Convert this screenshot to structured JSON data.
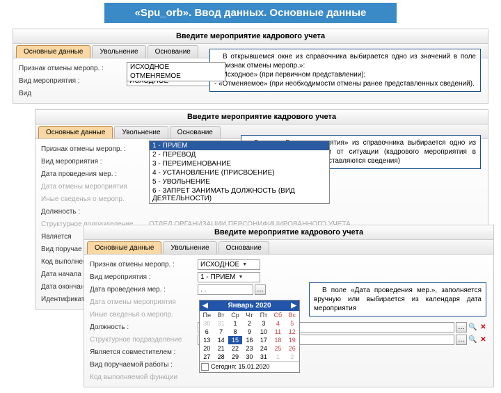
{
  "banner_title": "«Spu_orb». Ввод данных. Основные данные",
  "panel_title": "Введите мероприятие кадрового учета",
  "tabs": [
    "Основные данные",
    "Увольнение",
    "Основание"
  ],
  "labels": {
    "cancel_sign": "Признак отмены меропр. :",
    "event_type": "Вид мероприятия :",
    "event_date": "Дата проведения мер. :",
    "cancel_date": "Дата отмены мероприятия",
    "other_info": "Иные сведенья о меропр.",
    "position": "Должность :",
    "struct_unit": "Структурное подразделение",
    "is_combiner": "Является совместителем :",
    "has_function": "Вид поручаемой работы :",
    "exec_code": "Код выполняемой функции",
    "code_exec": "Код выполнения",
    "date_start": "Дата начала :",
    "date_end": "Дата окончания",
    "identifier": "Идентификатор"
  },
  "dropdown1": {
    "opt1": "ИСХОДНОЕ",
    "opt2": "ОТМЕНЯЕМОЕ"
  },
  "dropdown2": {
    "sel": "1 - ПРИЕМ",
    "o1": "1 - ПРИЕМ",
    "o2": "2 - ПЕРЕВОД",
    "o3": "3 - ПЕРЕИМЕНОВАНИЕ",
    "o4": "4 - УСТАНОВЛЕНИЕ (ПРИСВОЕНИЕ)",
    "o5": "5 - УВОЛЬНЕНИЕ",
    "o6": "6 - ЗАПРЕТ ЗАНИМАТЬ ДОЛЖНОСТЬ (ВИД ДЕЯТЕЛЬНОСТИ)"
  },
  "values": {
    "cancel_sel": "ИСХОДНОЕ",
    "event_sel3": "1 - ПРИЕМ",
    "date3": ". .",
    "struct_cut": "ОТДЕЛ ОРГАНИЗАЦИИ ПЕРСОНИФИЦИРОВАННОГО УЧЕТА"
  },
  "callout1": {
    "p1": "В открывшемся окне из справочника выбирается одно из значений в поле «Признак отмены меропр.»:",
    "p2": "- «Исходное» (при первичном представлении);",
    "p3": "- «Отменяемое» (при необходимости отмены ранее представленных сведений)."
  },
  "callout2": "В поле «Вид мероприятия» из справочника выбирается одно из значений в зависимости от ситуации (кадрового мероприятия в отношении которого представляются сведения)",
  "callout3": "В поле «Дата проведения мер.», заполняется вручную или выбирается из календаря дата мероприятия",
  "calendar": {
    "month": "Январь 2020",
    "dow": [
      "Пн",
      "Вт",
      "Ср",
      "Чт",
      "Пт",
      "Сб",
      "Вс"
    ],
    "today_label": "Сегодня: 15.01.2020",
    "weeks": [
      [
        "30",
        "31",
        "1",
        "2",
        "3",
        "4",
        "5"
      ],
      [
        "6",
        "7",
        "8",
        "9",
        "10",
        "11",
        "12"
      ],
      [
        "13",
        "14",
        "15",
        "16",
        "17",
        "18",
        "19"
      ],
      [
        "20",
        "21",
        "22",
        "23",
        "24",
        "25",
        "26"
      ],
      [
        "27",
        "28",
        "29",
        "30",
        "31",
        "1",
        "2"
      ]
    ]
  }
}
